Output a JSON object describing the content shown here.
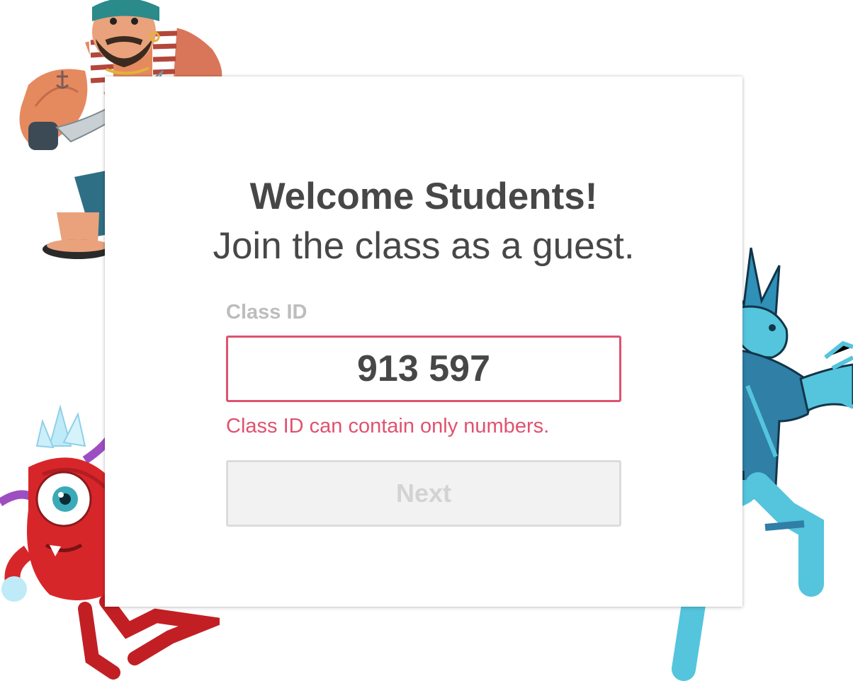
{
  "header": {
    "title": "Welcome Students!",
    "subtitle": "Join the class as a guest."
  },
  "form": {
    "class_id_label": "Class ID",
    "class_id_value": "913 597",
    "error_message": "Class ID can contain only numbers.",
    "next_label": "Next",
    "next_enabled": false
  },
  "colors": {
    "error": "#e0526e",
    "heading": "#474747",
    "label": "#bdbdbd",
    "button_disabled_bg": "#f2f2f2",
    "button_disabled_text": "#d3d3d3"
  },
  "decorations": [
    "pirate-character",
    "red-monster-character",
    "ice-hero-character"
  ]
}
